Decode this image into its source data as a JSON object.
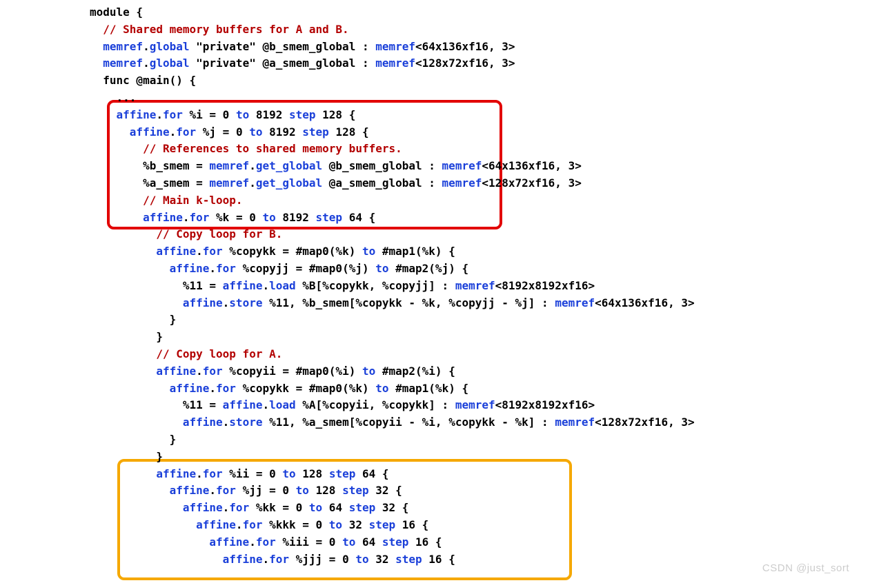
{
  "code": {
    "l00": {
      "plain": "module {"
    },
    "l01": {
      "indent": "  ",
      "comment": "// Shared memory buffers for A and B."
    },
    "l02": {
      "indent": "  ",
      "t1": "memref",
      "t2": ".",
      "t3": "global",
      "t4": " \"private\" @b_smem_global : ",
      "t5": "memref",
      "t6": "<64x136xf16, 3>"
    },
    "l03": {
      "indent": "  ",
      "t1": "memref",
      "t2": ".",
      "t3": "global",
      "t4": " \"private\" @a_smem_global : ",
      "t5": "memref",
      "t6": "<128x72xf16, 3>"
    },
    "l04": {
      "indent": "  ",
      "plain": "func @main() {"
    },
    "l05": {
      "indent": "    ",
      "dots": "..."
    },
    "l06": {
      "indent": "    ",
      "t1": "affine",
      "t2": ".",
      "t3": "for",
      "t4": " %i = 0 ",
      "t5": "to",
      "t6": " 8192 ",
      "t7": "step",
      "t8": " 128 {"
    },
    "l07": {
      "indent": "      ",
      "t1": "affine",
      "t2": ".",
      "t3": "for",
      "t4": " %j = 0 ",
      "t5": "to",
      "t6": " 8192 ",
      "t7": "step",
      "t8": " 128 {"
    },
    "l08": {
      "indent": "        ",
      "comment": "// References to shared memory buffers."
    },
    "l09": {
      "indent": "        ",
      "t1": "%b_smem = ",
      "t2": "memref",
      "t3": ".",
      "t4": "get_global",
      "t5": " @b_smem_global : ",
      "t6": "memref",
      "t7": "<64x136xf16, 3>"
    },
    "l10": {
      "indent": "        ",
      "t1": "%a_smem = ",
      "t2": "memref",
      "t3": ".",
      "t4": "get_global",
      "t5": " @a_smem_global : ",
      "t6": "memref",
      "t7": "<128x72xf16, 3>"
    },
    "l11": {
      "indent": "        ",
      "comment": "// Main k-loop."
    },
    "l12": {
      "indent": "        ",
      "t1": "affine",
      "t2": ".",
      "t3": "for",
      "t4": " %k = 0 ",
      "t5": "to",
      "t6": " 8192 ",
      "t7": "step",
      "t8": " 64 {"
    },
    "l13": {
      "indent": "          ",
      "comment": "// Copy loop for B."
    },
    "l14": {
      "indent": "          ",
      "t1": "affine",
      "t2": ".",
      "t3": "for",
      "t4": " %copykk = #map0(%k) ",
      "t5": "to",
      "t6": " #map1(%k) {"
    },
    "l15": {
      "indent": "            ",
      "t1": "affine",
      "t2": ".",
      "t3": "for",
      "t4": " %copyjj = #map0(%j) ",
      "t5": "to",
      "t6": " #map2(%j) {"
    },
    "l16": {
      "indent": "              ",
      "t1": "%11 = ",
      "t2": "affine",
      "t3": ".",
      "t4": "load",
      "t5": " %B[%copykk, %copyjj] : ",
      "t6": "memref",
      "t7": "<8192x8192xf16>"
    },
    "l17": {
      "indent": "              ",
      "t1": "affine",
      "t2": ".",
      "t3": "store",
      "t4": " %11, %b_smem[%copykk - %k, %copyjj - %j] : ",
      "t5": "memref",
      "t6": "<64x136xf16, 3>"
    },
    "l18": {
      "indent": "            ",
      "plain": "}"
    },
    "l19": {
      "indent": "          ",
      "plain": "}"
    },
    "l20": {
      "indent": "          ",
      "comment": "// Copy loop for A."
    },
    "l21": {
      "indent": "          ",
      "t1": "affine",
      "t2": ".",
      "t3": "for",
      "t4": " %copyii = #map0(%i) ",
      "t5": "to",
      "t6": " #map2(%i) {"
    },
    "l22": {
      "indent": "            ",
      "t1": "affine",
      "t2": ".",
      "t3": "for",
      "t4": " %copykk = #map0(%k) ",
      "t5": "to",
      "t6": " #map1(%k) {"
    },
    "l23": {
      "indent": "              ",
      "t1": "%11 = ",
      "t2": "affine",
      "t3": ".",
      "t4": "load",
      "t5": " %A[%copyii, %copykk] : ",
      "t6": "memref",
      "t7": "<8192x8192xf16>"
    },
    "l24": {
      "indent": "              ",
      "t1": "affine",
      "t2": ".",
      "t3": "store",
      "t4": " %11, %a_smem[%copyii - %i, %copykk - %k] : ",
      "t5": "memref",
      "t6": "<128x72xf16, 3>"
    },
    "l25": {
      "indent": "            ",
      "plain": "}"
    },
    "l26": {
      "indent": "          ",
      "plain": "}"
    },
    "l27": {
      "indent": "          ",
      "t1": "affine",
      "t2": ".",
      "t3": "for",
      "t4": " %ii = 0 ",
      "t5": "to",
      "t6": " 128 ",
      "t7": "step",
      "t8": " 64 {"
    },
    "l28": {
      "indent": "            ",
      "t1": "affine",
      "t2": ".",
      "t3": "for",
      "t4": " %jj = 0 ",
      "t5": "to",
      "t6": " 128 ",
      "t7": "step",
      "t8": " 32 {"
    },
    "l29": {
      "indent": "              ",
      "t1": "affine",
      "t2": ".",
      "t3": "for",
      "t4": " %kk = 0 ",
      "t5": "to",
      "t6": " 64 ",
      "t7": "step",
      "t8": " 32 {"
    },
    "l30": {
      "indent": "                ",
      "t1": "affine",
      "t2": ".",
      "t3": "for",
      "t4": " %kkk = 0 ",
      "t5": "to",
      "t6": " 32 ",
      "t7": "step",
      "t8": " 16 {"
    },
    "l31": {
      "indent": "                  ",
      "t1": "affine",
      "t2": ".",
      "t3": "for",
      "t4": " %iii = 0 ",
      "t5": "to",
      "t6": " 64 ",
      "t7": "step",
      "t8": " 16 {"
    },
    "l32": {
      "indent": "                    ",
      "t1": "affine",
      "t2": ".",
      "t3": "for",
      "t4": " %jjj = 0 ",
      "t5": "to",
      "t6": " 32 ",
      "t7": "step",
      "t8": " 16 {"
    }
  },
  "watermark": "CSDN @just_sort"
}
